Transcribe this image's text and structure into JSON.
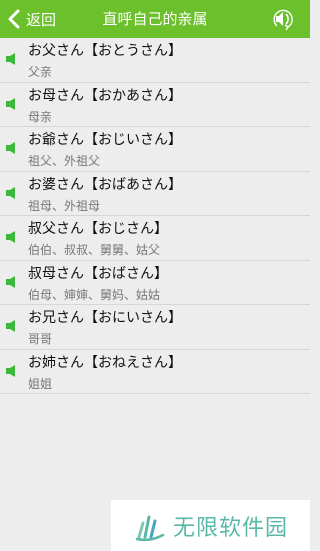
{
  "header": {
    "back_label": "返回",
    "title": "直呼自己的亲属"
  },
  "colors": {
    "header_bg": "#6cc02b",
    "speaker_icon": "#3cb83c",
    "watermark_text": "#5ab8a8"
  },
  "items": [
    {
      "jp": "お父さん【おとうさん】",
      "cn": "父亲"
    },
    {
      "jp": "お母さん【おかあさん】",
      "cn": "母亲"
    },
    {
      "jp": "お爺さん【おじいさん】",
      "cn": "祖父、外祖父"
    },
    {
      "jp": "お婆さん【おばあさん】",
      "cn": "祖母、外祖母"
    },
    {
      "jp": "叔父さん【おじさん】",
      "cn": "伯伯、叔叔、舅舅、姑父"
    },
    {
      "jp": "叔母さん【おばさん】",
      "cn": "伯母、婶婶、舅妈、姑姑"
    },
    {
      "jp": "お兄さん【おにいさん】",
      "cn": "哥哥"
    },
    {
      "jp": "お姉さん【おねえさん】",
      "cn": "姐姐"
    }
  ],
  "watermark": {
    "text": "无限软件园"
  }
}
